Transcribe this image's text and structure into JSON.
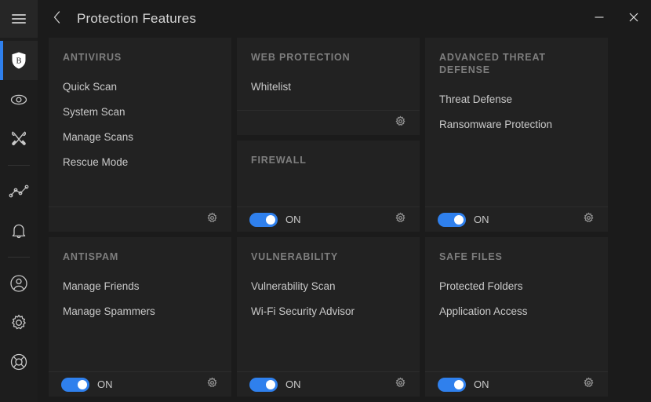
{
  "window": {
    "title": "Protection Features",
    "back_icon": "chevron-left-icon",
    "minimize_label": "—",
    "close_label": "✕",
    "accent_color": "#2f80ed",
    "background_color": "#1b1b1b",
    "card_color": "#222222"
  },
  "sidebar": {
    "menu_icon": "hamburger-menu-icon",
    "items": [
      {
        "name": "protection",
        "icon": "bitdefender-shield-icon",
        "active": true
      },
      {
        "name": "privacy",
        "icon": "eye-icon",
        "active": false
      },
      {
        "name": "utilities",
        "icon": "tools-icon",
        "active": false
      },
      {
        "name": "activity",
        "icon": "line-chart-icon",
        "active": false
      },
      {
        "name": "notifications",
        "icon": "bell-icon",
        "active": false
      },
      {
        "name": "account",
        "icon": "user-circle-icon",
        "active": false
      },
      {
        "name": "settings",
        "icon": "gear-icon",
        "active": false
      },
      {
        "name": "support",
        "icon": "lifebuoy-icon",
        "active": false
      }
    ]
  },
  "cards": [
    {
      "id": "antivirus",
      "title": "ANTIVIRUS",
      "links": [
        "Quick Scan",
        "System Scan",
        "Manage Scans",
        "Rescue Mode"
      ],
      "toggle": null,
      "gear_icon": "gear-icon"
    },
    {
      "id": "web-protection",
      "title": "WEB PROTECTION",
      "links": [
        "Whitelist"
      ],
      "toggle": null,
      "gear_icon": "gear-icon"
    },
    {
      "id": "firewall",
      "title": "FIREWALL",
      "links": [],
      "toggle": {
        "state": "ON",
        "on": true
      },
      "gear_icon": "gear-icon"
    },
    {
      "id": "advanced-threat-defense",
      "title": "ADVANCED THREAT DEFENSE",
      "links": [
        "Threat Defense",
        "Ransomware Protection"
      ],
      "toggle": {
        "state": "ON",
        "on": true
      },
      "gear_icon": "gear-icon"
    },
    {
      "id": "antispam",
      "title": "ANTISPAM",
      "links": [
        "Manage Friends",
        "Manage Spammers"
      ],
      "toggle": {
        "state": "ON",
        "on": true
      },
      "gear_icon": "gear-icon"
    },
    {
      "id": "vulnerability",
      "title": "VULNERABILITY",
      "links": [
        "Vulnerability Scan",
        "Wi-Fi Security Advisor"
      ],
      "toggle": {
        "state": "ON",
        "on": true
      },
      "gear_icon": "gear-icon"
    },
    {
      "id": "safe-files",
      "title": "SAFE FILES",
      "links": [
        "Protected Folders",
        "Application Access"
      ],
      "toggle": {
        "state": "ON",
        "on": true
      },
      "gear_icon": "gear-icon"
    }
  ]
}
